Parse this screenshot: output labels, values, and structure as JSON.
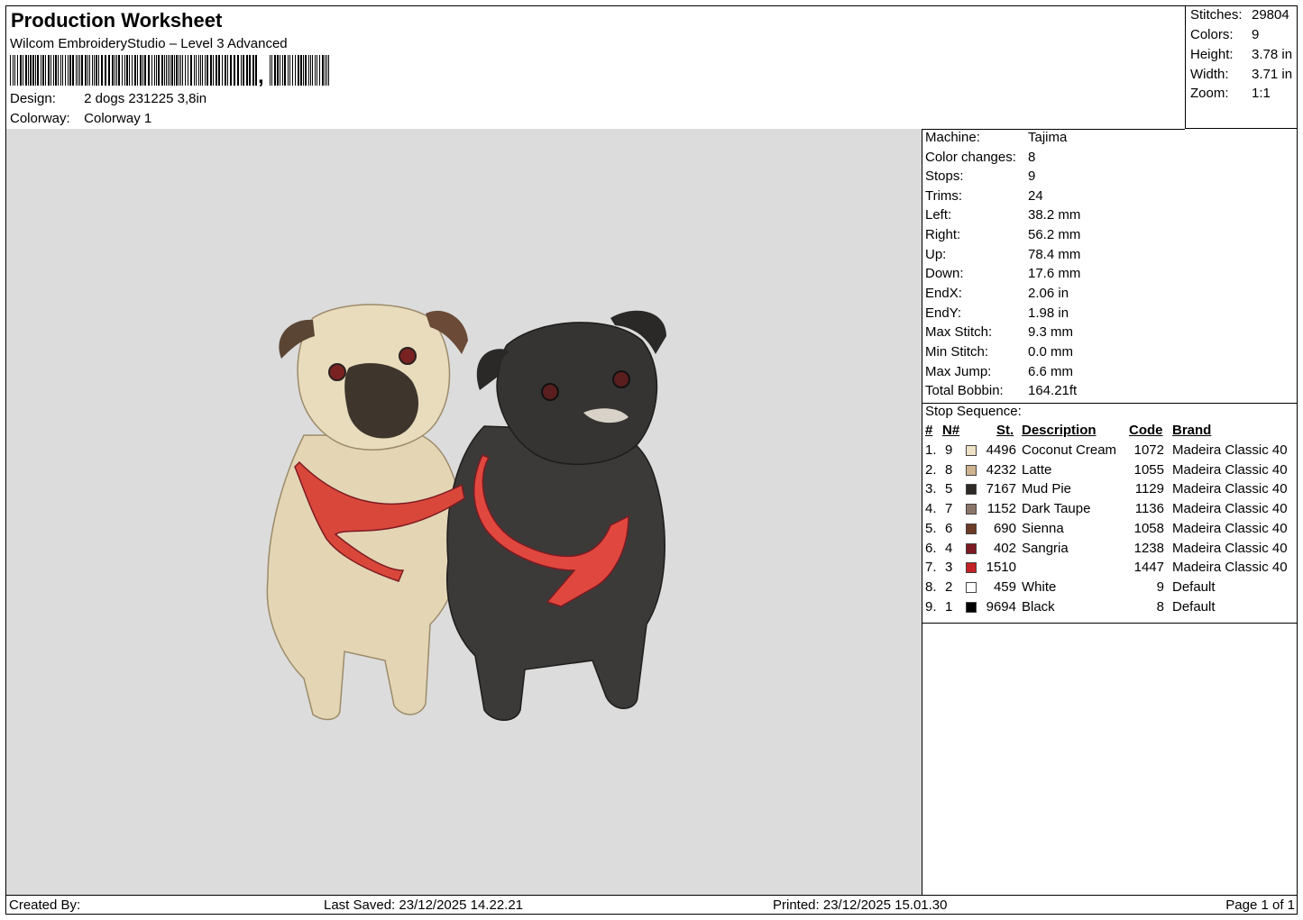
{
  "header": {
    "title": "Production Worksheet",
    "subtitle": "Wilcom EmbroideryStudio – Level 3 Advanced",
    "barcode_suffix": ",",
    "design_label": "Design:",
    "design_value": "2 dogs 231225 3,8in",
    "colorway_label": "Colorway:",
    "colorway_value": "Colorway 1"
  },
  "stats": [
    {
      "label": "Stitches:",
      "value": "29804"
    },
    {
      "label": "Colors:",
      "value": "9"
    },
    {
      "label": "Height:",
      "value": "3.78 in"
    },
    {
      "label": "Width:",
      "value": "3.71 in"
    },
    {
      "label": "Zoom:",
      "value": "1:1"
    }
  ],
  "machine_info": [
    {
      "label": "Machine:",
      "value": "Tajima"
    },
    {
      "label": "Color changes:",
      "value": "8"
    },
    {
      "label": "Stops:",
      "value": "9"
    },
    {
      "label": "Trims:",
      "value": "24"
    },
    {
      "label": "Left:",
      "value": "38.2 mm"
    },
    {
      "label": "Right:",
      "value": "56.2 mm"
    },
    {
      "label": "Up:",
      "value": "78.4 mm"
    },
    {
      "label": "Down:",
      "value": "17.6 mm"
    },
    {
      "label": "EndX:",
      "value": "2.06 in"
    },
    {
      "label": "EndY:",
      "value": "1.98 in"
    },
    {
      "label": "Max Stitch:",
      "value": "9.3 mm"
    },
    {
      "label": "Min Stitch:",
      "value": "0.0 mm"
    },
    {
      "label": "Max Jump:",
      "value": "6.6 mm"
    },
    {
      "label": "Total Bobbin:",
      "value": "164.21ft"
    }
  ],
  "stop_sequence": {
    "title": "Stop Sequence:",
    "headers": {
      "idx": "#",
      "n": "N#",
      "st": "St.",
      "description": "Description",
      "code": "Code",
      "brand": "Brand"
    },
    "rows": [
      {
        "idx": "1.",
        "n": "9",
        "color": "#efe1c6",
        "st": "4496",
        "description": "Coconut Cream",
        "code": "1072",
        "brand": "Madeira Classic 40"
      },
      {
        "idx": "2.",
        "n": "8",
        "color": "#cdb48e",
        "st": "4232",
        "description": "Latte",
        "code": "1055",
        "brand": "Madeira Classic 40"
      },
      {
        "idx": "3.",
        "n": "5",
        "color": "#2f2a26",
        "st": "7167",
        "description": "Mud Pie",
        "code": "1129",
        "brand": "Madeira Classic 40"
      },
      {
        "idx": "4.",
        "n": "7",
        "color": "#8a7668",
        "st": "1152",
        "description": "Dark Taupe",
        "code": "1136",
        "brand": "Madeira Classic 40"
      },
      {
        "idx": "5.",
        "n": "6",
        "color": "#6b3b28",
        "st": "690",
        "description": "Sienna",
        "code": "1058",
        "brand": "Madeira Classic 40"
      },
      {
        "idx": "6.",
        "n": "4",
        "color": "#7d1a22",
        "st": "402",
        "description": "Sangria",
        "code": "1238",
        "brand": "Madeira Classic 40"
      },
      {
        "idx": "7.",
        "n": "3",
        "color": "#c42226",
        "st": "1510",
        "description": "",
        "code": "1447",
        "brand": "Madeira Classic 40"
      },
      {
        "idx": "8.",
        "n": "2",
        "color": "#ffffff",
        "st": "459",
        "description": "White",
        "code": "9",
        "brand": "Default"
      },
      {
        "idx": "9.",
        "n": "1",
        "color": "#000000",
        "st": "9694",
        "description": "Black",
        "code": "8",
        "brand": "Default"
      }
    ]
  },
  "footer": {
    "created_by": "Created By:",
    "last_saved": "Last Saved: 23/12/2025 14.22.21",
    "printed": "Printed: 23/12/2025 15.01.30",
    "page": "Page 1 of 1"
  },
  "colors": {
    "design_background": "#dcdcdc",
    "fawn_pug": "#e4d6b5",
    "black_pug": "#3b3a38",
    "harness": "#d9473b"
  }
}
